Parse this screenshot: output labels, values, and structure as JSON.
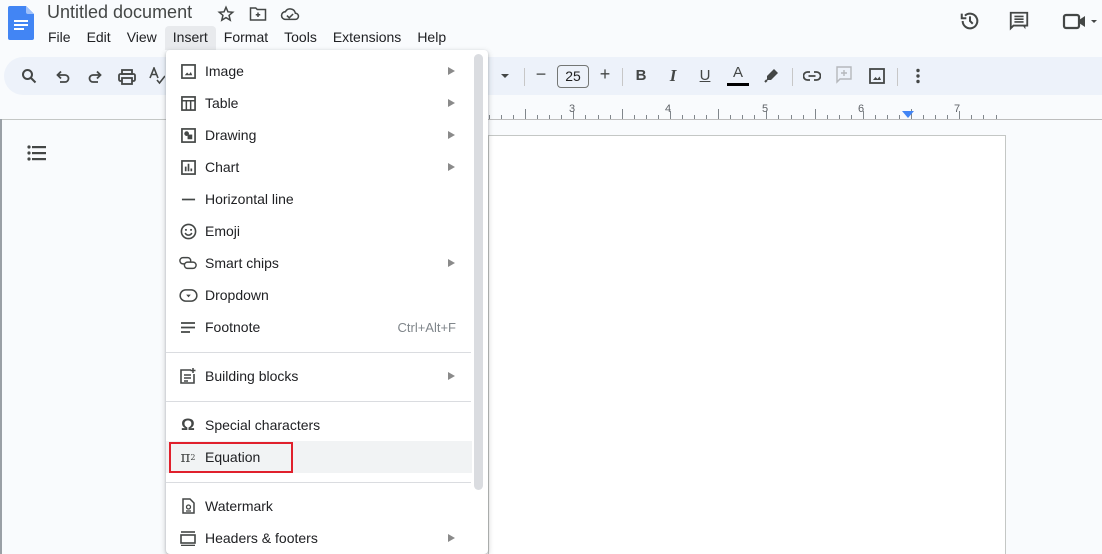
{
  "header": {
    "doc_title": "Untitled document",
    "icons": [
      "star-icon",
      "move-to-folder-icon",
      "cloud-saved-icon"
    ],
    "right_icons": [
      "version-history-icon",
      "comments-icon",
      "meet-icon"
    ]
  },
  "menubar": {
    "items": [
      "File",
      "Edit",
      "View",
      "Insert",
      "Format",
      "Tools",
      "Extensions",
      "Help"
    ],
    "active": "Insert"
  },
  "toolbar": {
    "font_size": "25",
    "minus_label": "−",
    "plus_label": "+",
    "bold_label": "B",
    "italic_label": "I",
    "underline_label": "U",
    "text_color_label": "A",
    "text_color": "#000000"
  },
  "ruler": {
    "labels": [
      "3",
      "4",
      "5",
      "6",
      "7"
    ],
    "indent_marker_color": "#4285f4"
  },
  "insert_menu": {
    "items": [
      {
        "label": "Image",
        "icon": "image-icon",
        "submenu": true
      },
      {
        "label": "Table",
        "icon": "table-icon",
        "submenu": true
      },
      {
        "label": "Drawing",
        "icon": "drawing-icon",
        "submenu": true
      },
      {
        "label": "Chart",
        "icon": "chart-icon",
        "submenu": true
      },
      {
        "label": "Horizontal line",
        "icon": "horizontal-line-icon",
        "submenu": false
      },
      {
        "label": "Emoji",
        "icon": "emoji-icon",
        "submenu": false
      },
      {
        "label": "Smart chips",
        "icon": "smart-chips-icon",
        "submenu": true
      },
      {
        "label": "Dropdown",
        "icon": "dropdown-icon",
        "submenu": false
      },
      {
        "label": "Footnote",
        "icon": "footnote-icon",
        "submenu": false,
        "shortcut": "Ctrl+Alt+F"
      },
      {
        "label": "Building blocks",
        "icon": "building-blocks-icon",
        "submenu": true
      },
      {
        "label": "Special characters",
        "icon": "omega-icon",
        "submenu": false
      },
      {
        "label": "Equation",
        "icon": "pi-squared-icon",
        "submenu": false,
        "highlighted": true
      },
      {
        "label": "Watermark",
        "icon": "watermark-icon",
        "submenu": false
      },
      {
        "label": "Headers & footers",
        "icon": "headers-footers-icon",
        "submenu": true
      }
    ],
    "highlight_color": "#e0202c"
  }
}
